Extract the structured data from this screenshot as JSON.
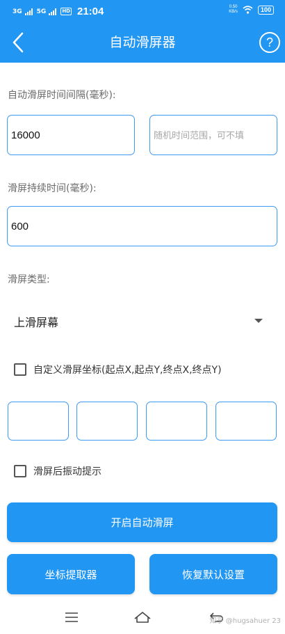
{
  "status_bar": {
    "network_1": "3G",
    "network_2": "5G",
    "hd": "HD",
    "time": "21:04",
    "speed_value": "0.50",
    "speed_unit": "KB/s",
    "battery": "100"
  },
  "app_bar": {
    "title": "自动滑屏器",
    "back_icon": "chevron-left-icon",
    "help_icon": "question-circle-icon",
    "help_glyph": "?"
  },
  "form": {
    "interval_label": "自动滑屏时间间隔(毫秒):",
    "interval_value": "16000",
    "random_placeholder": "随机时间范围，可不填",
    "duration_label": "滑屏持续时间(毫秒):",
    "duration_value": "600",
    "type_label": "滑屏类型:",
    "type_selected": "上滑屏幕",
    "custom_coords_label": "自定义滑屏坐标(起点X,起点Y,终点X,终点Y)",
    "custom_coords_checked": false,
    "vibrate_label": "滑屏后振动提示",
    "vibrate_checked": false
  },
  "buttons": {
    "start": "开启自动滑屏",
    "coord_picker": "坐标提取器",
    "reset": "恢复默认设置"
  },
  "nav_bar": {
    "menu_icon": "menu-icon",
    "home_icon": "home-icon",
    "back_icon": "back-arrow-icon"
  },
  "watermark": "知乎 @hugsahuer 23"
}
